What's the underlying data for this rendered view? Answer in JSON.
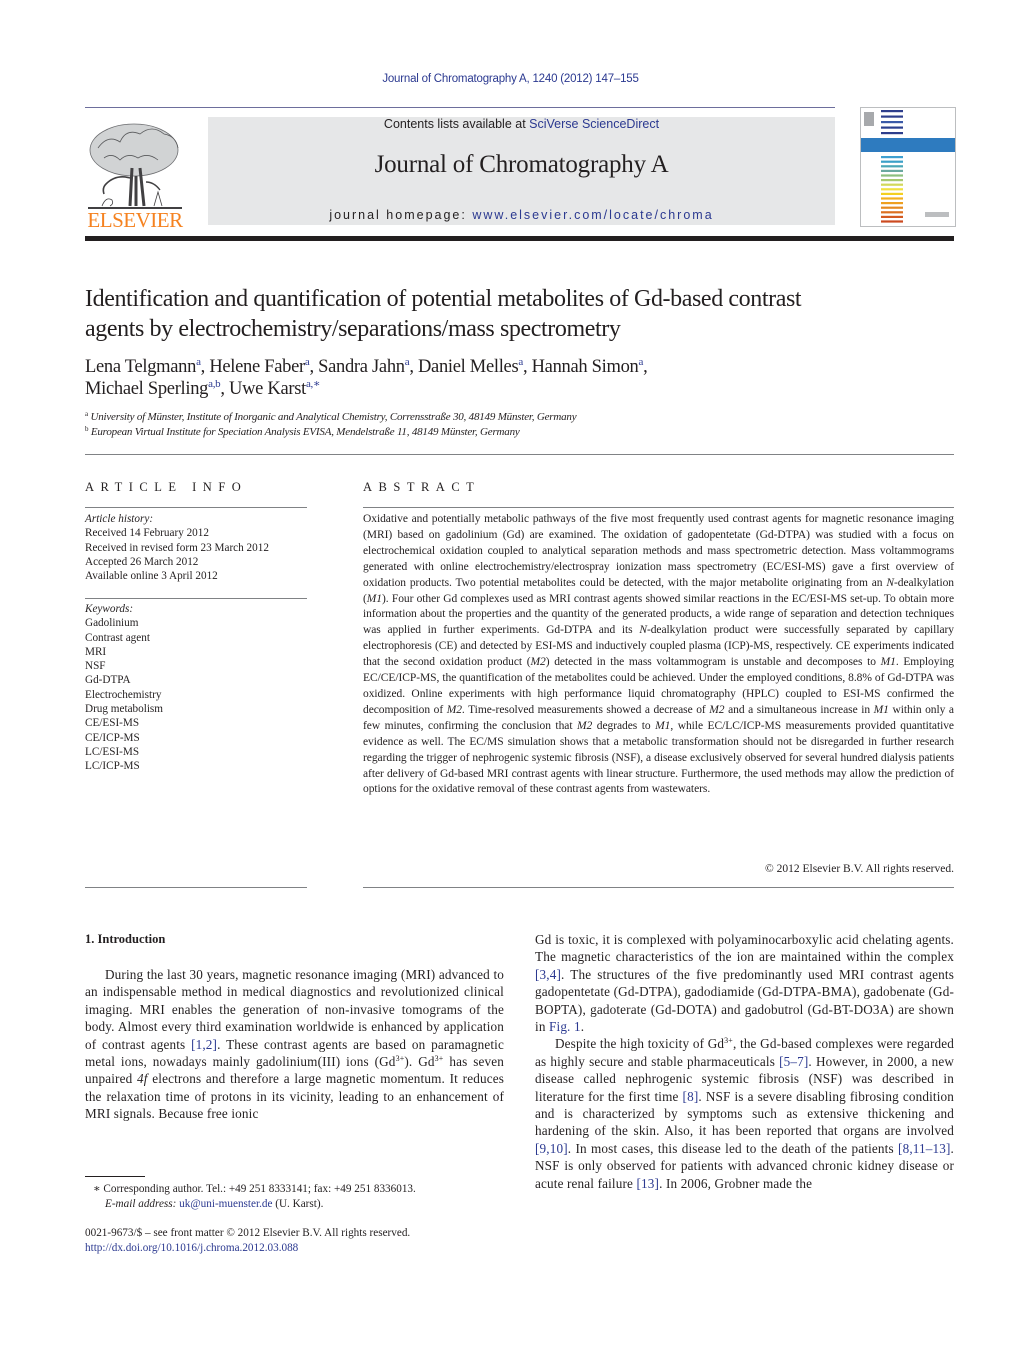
{
  "header": {
    "citation": "Journal of Chromatography A, 1240 (2012) 147–155",
    "contents_prefix": "Contents lists available at ",
    "contents_link": "SciVerse ScienceDirect",
    "journal_title": "Journal of Chromatography A",
    "homepage_prefix": "journal homepage: ",
    "homepage_url": "www.elsevier.com/locate/chroma",
    "publisher_logo_text": "ELSEVIER",
    "cover_stripe_colors": [
      "#2e3e8c",
      "#2e3e8c",
      "#3a5aa8",
      "#2a3f8e",
      "#2e3e8c",
      "#3fa0d0",
      "#3aa0c8",
      "#4aa7b7",
      "#6aa8a0",
      "#8cbf7e",
      "#a6c870",
      "#d2d85a",
      "#f0e040",
      "#f4d020",
      "#f2b020",
      "#eea020",
      "#e48a20",
      "#dc7020",
      "#d45a20",
      "#cc4a20"
    ],
    "cover_band_color": "#2e7bbf"
  },
  "article": {
    "title_line1": "Identification and quantification of potential metabolites of Gd-based contrast",
    "title_line2": "agents by electrochemistry/separations/mass spectrometry",
    "authors": [
      {
        "name": "Lena Telgmann",
        "aff": "a"
      },
      {
        "name": "Helene Faber",
        "aff": "a"
      },
      {
        "name": "Sandra Jahn",
        "aff": "a"
      },
      {
        "name": "Daniel Melles",
        "aff": "a"
      },
      {
        "name": "Hannah Simon",
        "aff": "a"
      },
      {
        "name": "Michael Sperling",
        "aff": "a,b"
      },
      {
        "name": "Uwe Karst",
        "aff": "a,∗"
      }
    ],
    "affiliations": [
      {
        "key": "a",
        "text": "University of Münster, Institute of Inorganic and Analytical Chemistry, Corrensstraße 30, 48149 Münster, Germany"
      },
      {
        "key": "b",
        "text": "European Virtual Institute for Speciation Analysis EVISA, Mendelstraße 11, 48149 Münster, Germany"
      }
    ]
  },
  "article_info": {
    "heading": "ARTICLE INFO",
    "history_label": "Article history:",
    "history": [
      "Received 14 February 2012",
      "Received in revised form 23 March 2012",
      "Accepted 26 March 2012",
      "Available online 3 April 2012"
    ],
    "keywords_label": "Keywords:",
    "keywords": [
      "Gadolinium",
      "Contrast agent",
      "MRI",
      "NSF",
      "Gd-DTPA",
      "Electrochemistry",
      "Drug metabolism",
      "CE/ESI-MS",
      "CE/ICP-MS",
      "LC/ESI-MS",
      "LC/ICP-MS"
    ]
  },
  "abstract": {
    "heading": "ABSTRACT",
    "segments": [
      {
        "t": "Oxidative and potentially metabolic pathways of the five most frequently used contrast agents for magnetic resonance imaging (MRI) based on gadolinium (Gd) are examined. The oxidation of gadopentetate (Gd-DTPA) was studied with a focus on electrochemical oxidation coupled to analytical separation methods and mass spectrometric detection. Mass voltammograms generated with online electrochemistry/electrospray ionization mass spectrometry (EC/ESI-MS) gave a first overview of oxidation products. Two potential metabolites could be detected, with the major metabolite originating from an "
      },
      {
        "t": "N",
        "i": true
      },
      {
        "t": "-dealkylation ("
      },
      {
        "t": "M1",
        "i": true
      },
      {
        "t": "). Four other Gd complexes used as MRI contrast agents showed similar reactions in the EC/ESI-MS set-up. To obtain more information about the properties and the quantity of the generated products, a wide range of separation and detection techniques was applied in further experiments. Gd-DTPA and its "
      },
      {
        "t": "N",
        "i": true
      },
      {
        "t": "-dealkylation product were successfully separated by capillary electrophoresis (CE) and detected by ESI-MS and inductively coupled plasma (ICP)-MS, respectively. CE experiments indicated that the second oxidation product ("
      },
      {
        "t": "M2",
        "i": true
      },
      {
        "t": ") detected in the mass voltammogram is unstable and decomposes to "
      },
      {
        "t": "M1",
        "i": true
      },
      {
        "t": ". Employing EC/CE/ICP-MS, the quantification of the metabolites could be achieved. Under the employed conditions, 8.8% of Gd-DTPA was oxidized. Online experiments with high performance liquid chromatography (HPLC) coupled to ESI-MS confirmed the decomposition of "
      },
      {
        "t": "M2",
        "i": true
      },
      {
        "t": ". Time-resolved measurements showed a decrease of "
      },
      {
        "t": "M2",
        "i": true
      },
      {
        "t": " and a simultaneous increase in "
      },
      {
        "t": "M1",
        "i": true
      },
      {
        "t": " within only a few minutes, confirming the conclusion that "
      },
      {
        "t": "M2",
        "i": true
      },
      {
        "t": " degrades to "
      },
      {
        "t": "M1",
        "i": true
      },
      {
        "t": ", while EC/LC/ICP-MS measurements provided quantitative evidence as well. The EC/MS simulation shows that a metabolic transformation should not be disregarded in further research regarding the trigger of nephrogenic systemic fibrosis (NSF), a disease exclusively observed for several hundred dialysis patients after delivery of Gd-based MRI contrast agents with linear structure. Furthermore, the used methods may allow the prediction of options for the oxidative removal of these contrast agents from wastewaters."
      }
    ],
    "copyright": "© 2012 Elsevier B.V. All rights reserved."
  },
  "body": {
    "section_heading": "1.  Introduction",
    "left_column": [
      {
        "t": "During the last 30 years, magnetic resonance imaging (MRI) advanced to an indispensable method in medical diagnostics and revolutionized clinical imaging. MRI enables the generation of non-invasive tomograms of the body. Almost every third examination worldwide is enhanced by application of contrast agents "
      },
      {
        "t": "[1,2]",
        "ref": true
      },
      {
        "t": ". These contrast agents are based on paramagnetic metal ions, nowadays mainly gadolinium(III) ions (Gd"
      },
      {
        "t": "3+",
        "sup": true
      },
      {
        "t": "). Gd"
      },
      {
        "t": "3+",
        "sup": true
      },
      {
        "t": " has seven unpaired "
      },
      {
        "t": "4f",
        "i": true
      },
      {
        "t": " electrons and therefore a large magnetic momentum. It reduces the relaxation time of protons in its vicinity, leading to an enhancement of MRI signals. Because free ionic"
      }
    ],
    "right_column_p1": [
      {
        "t": "Gd is toxic, it is complexed with polyaminocarboxylic acid chelating agents. The magnetic characteristics of the ion are maintained within the complex "
      },
      {
        "t": "[3,4]",
        "ref": true
      },
      {
        "t": ". The structures of the five predominantly used MRI contrast agents gadopentetate (Gd-DTPA), gadodiamide (Gd-DTPA-BMA), gadobenate (Gd-BOPTA), gadoterate (Gd-DOTA) and gadobutrol (Gd-BT-DO3A) are shown in "
      },
      {
        "t": "Fig. 1",
        "ref": true
      },
      {
        "t": "."
      }
    ],
    "right_column_p2": [
      {
        "t": "Despite the high toxicity of Gd"
      },
      {
        "t": "3+",
        "sup": true
      },
      {
        "t": ", the Gd-based complexes were regarded as highly secure and stable pharmaceuticals "
      },
      {
        "t": "[5–7]",
        "ref": true
      },
      {
        "t": ". However, in 2000, a new disease called nephrogenic systemic fibrosis (NSF) was described in literature for the first time "
      },
      {
        "t": "[8]",
        "ref": true
      },
      {
        "t": ". NSF is a severe disabling fibrosing condition and is characterized by symptoms such as extensive thickening and hardening of the skin. Also, it has been reported that organs are involved "
      },
      {
        "t": "[9,10]",
        "ref": true
      },
      {
        "t": ". In most cases, this disease led to the death of the patients "
      },
      {
        "t": "[8,11–13]",
        "ref": true
      },
      {
        "t": ". NSF is only observed for patients with advanced chronic kidney disease or acute renal failure "
      },
      {
        "t": "[13]",
        "ref": true
      },
      {
        "t": ". In 2006, Grobner made the"
      }
    ]
  },
  "footnotes": {
    "corresponding": "∗  Corresponding author. Tel.: +49 251 8333141; fax: +49 251 8336013.",
    "email_label": "E-mail address:",
    "email": "uk@uni-muenster.de",
    "email_suffix": " (U. Karst).",
    "issn_line": "0021-9673/$ – see front matter © 2012 Elsevier B.V. All rights reserved.",
    "doi": "http://dx.doi.org/10.1016/j.chroma.2012.03.088"
  }
}
